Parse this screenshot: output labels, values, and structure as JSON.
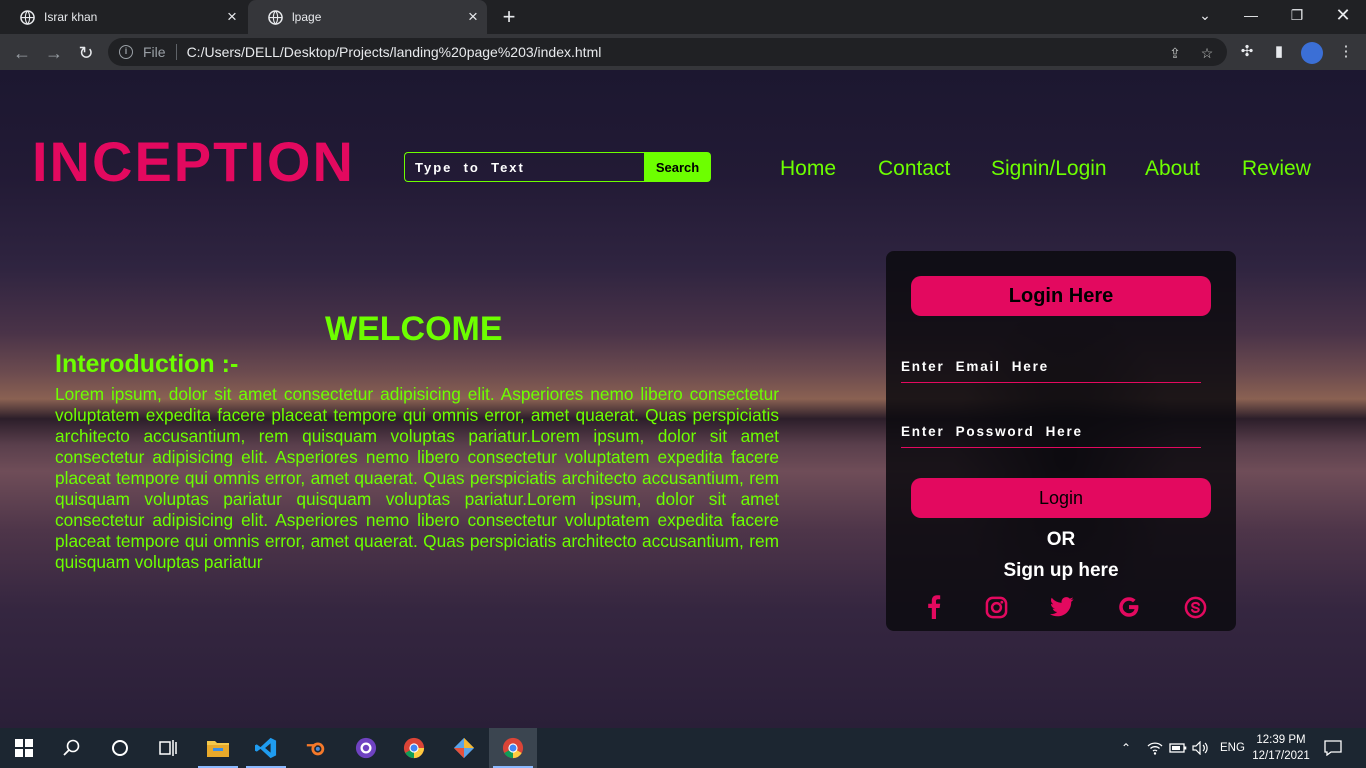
{
  "browser": {
    "tabs": [
      {
        "title": "Israr khan"
      },
      {
        "title": "lpage"
      }
    ],
    "omnibox": {
      "scheme_label": "File",
      "url": "C:/Users/DELL/Desktop/Projects/landing%20page%203/index.html"
    }
  },
  "page": {
    "brand": "INCEPTION",
    "search": {
      "placeholder": "Type  to  Text",
      "button_label": "Search"
    },
    "nav": [
      "Home",
      "Contact",
      "Signin/Login",
      "About",
      "Review"
    ],
    "welcome": "WELCOME",
    "intro_title": "Interoduction :-",
    "intro_text": "Lorem ipsum, dolor sit amet consectetur adipisicing elit. Asperiores nemo libero consectetur voluptatem expedita facere placeat tempore qui omnis error, amet quaerat. Quas perspiciatis architecto accusantium, rem quisquam voluptas pariatur.Lorem ipsum, dolor sit amet consectetur adipisicing elit. Asperiores nemo libero consectetur voluptatem expedita facere placeat tempore qui omnis error, amet quaerat. Quas perspiciatis architecto accusantium, rem quisquam voluptas pariatur quisquam voluptas pariatur.Lorem ipsum, dolor sit amet consectetur adipisicing elit. Asperiores nemo libero consectetur voluptatem expedita facere placeat tempore qui omnis error, amet quaerat. Quas perspiciatis architecto accusantium, rem quisquam voluptas pariatur",
    "login": {
      "heading": "Login Here",
      "email_placeholder": "Enter  Email  Here",
      "password_placeholder": "Enter  Possword  Here",
      "button_label": "Login",
      "or_label": "OR",
      "signup_label": "Sign up here",
      "social_icons": [
        "facebook-icon",
        "instagram-icon",
        "twitter-icon",
        "google-icon",
        "skype-icon"
      ]
    }
  },
  "taskbar": {
    "language": "ENG",
    "time": "12:39 PM",
    "date": "12/17/2021"
  },
  "colors": {
    "accent_pink": "#e3095f",
    "accent_green": "#6dff00"
  }
}
